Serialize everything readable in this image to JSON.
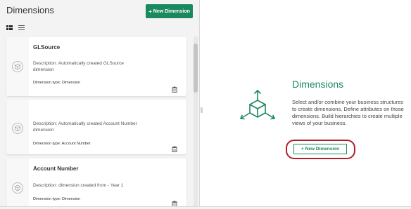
{
  "left_panel": {
    "title": "Dimensions",
    "new_button_label": "New Dimension",
    "cards": [
      {
        "title": "GLSource",
        "description": "Description: Automatically created GLSource dimension",
        "type": "Dimension type: Dimension"
      },
      {
        "title": "",
        "description": "Description: Automatically created Account Number dimension",
        "type": "Dimension type: Account Number"
      },
      {
        "title": "Account Number",
        "description": "Description: dimension created from - Year 1",
        "type": "Dimension type: Dimension"
      }
    ]
  },
  "right_panel": {
    "title": "Dimensions",
    "text": "Select and/or combine your business structures to create dimensions. Define attributes on those dimensions. Build hierarchies to create multiple views of your business.",
    "new_button_label": "New Dimension"
  },
  "colors": {
    "accent": "#1a8a5e",
    "highlight": "#b11f2a"
  }
}
